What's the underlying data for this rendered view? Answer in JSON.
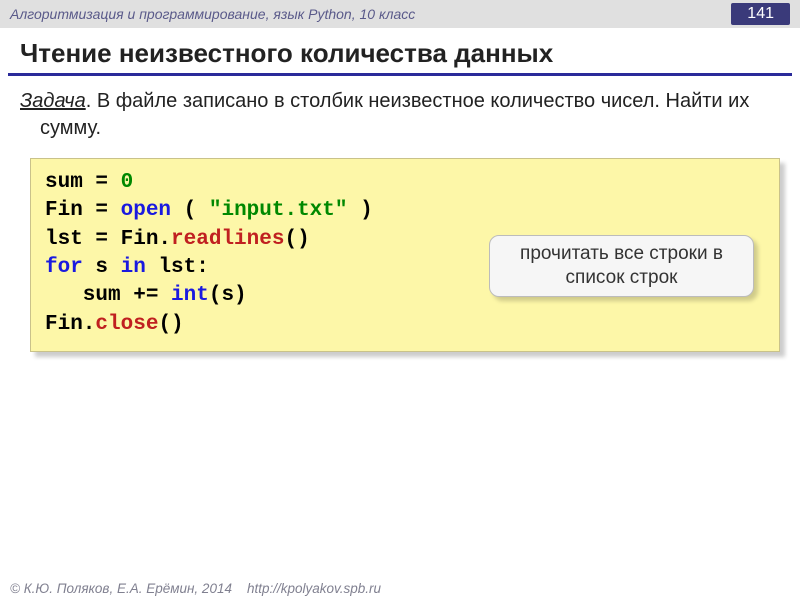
{
  "header": {
    "subject": "Алгоритмизация и программирование, язык Python, 10 класс",
    "page": "141"
  },
  "title": "Чтение неизвестного количества данных",
  "task": {
    "label": "Задача",
    "text": ". В файле записано в столбик неизвестное количество чисел. Найти их сумму."
  },
  "code": {
    "l1a": "sum",
    "l1b": " = ",
    "l1c": "0",
    "l2a": "Fin",
    "l2b": " = ",
    "l2c": "open",
    "l2d": " ( ",
    "l2e": "\"input.txt\"",
    "l2f": " )",
    "l3a": "lst",
    "l3b": " = ",
    "l3c": "Fin.",
    "l3d": "readlines",
    "l3e": "()",
    "l4a": "for",
    "l4b": " s ",
    "l4c": "in",
    "l4d": " lst:",
    "l5a": "   sum += ",
    "l5b": "int",
    "l5c": "(s)",
    "l6a": "Fin.",
    "l6b": "close",
    "l6c": "()"
  },
  "callout": "прочитать все строки в список строк",
  "footer": {
    "copyright": "© К.Ю. Поляков, Е.А. Ерёмин, 2014",
    "url": "http://kpolyakov.spb.ru"
  }
}
